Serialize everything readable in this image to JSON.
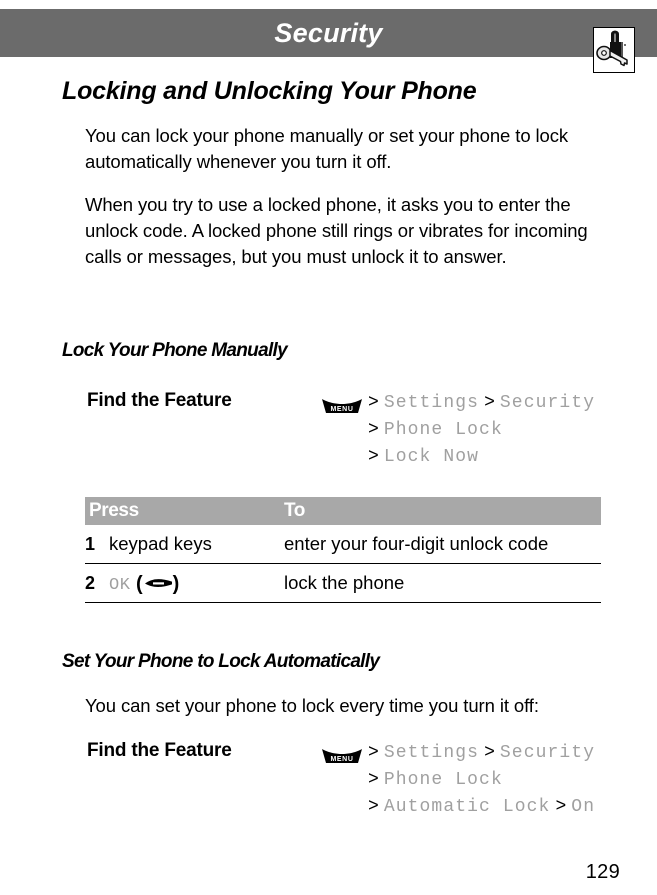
{
  "header": {
    "title": "Security",
    "band_color": "#6b6b6b",
    "icon_name": "padlock-and-key-icon"
  },
  "section": {
    "title": "Locking and Unlocking Your Phone",
    "paragraphs": [
      "You can lock your phone manually or set your phone to lock automatically whenever you turn it off.",
      "When you try to use a locked phone, it asks you to enter the unlock code. A locked phone still rings or vibrates for incoming calls or messages, but you must unlock it to answer."
    ]
  },
  "manual": {
    "subtitle": "Lock Your Phone Manually",
    "find_label": "Find the Feature",
    "menu_key_label": "MENU",
    "path_lines": [
      {
        "items": [
          {
            "sep": ">",
            "name": "Settings"
          },
          {
            "sep": ">",
            "name": "Security"
          }
        ]
      },
      {
        "items": [
          {
            "sep": ">",
            "name": "Phone Lock"
          }
        ]
      },
      {
        "items": [
          {
            "sep": ">",
            "name": "Lock Now"
          }
        ]
      }
    ],
    "table": {
      "columns": [
        "Press",
        "To"
      ],
      "rows": [
        {
          "num": "1",
          "press": "keypad keys",
          "press_mono": "",
          "press_softkey": false,
          "to": "enter your four-digit unlock code"
        },
        {
          "num": "2",
          "press": "",
          "press_mono": "OK",
          "press_softkey": true,
          "to": "lock the phone"
        }
      ]
    }
  },
  "automatic": {
    "subtitle": "Set Your Phone to Lock Automatically",
    "intro": "You can set your phone to lock every time you turn it off:",
    "find_label": "Find the Feature",
    "menu_key_label": "MENU",
    "path_lines": [
      {
        "items": [
          {
            "sep": ">",
            "name": "Settings"
          },
          {
            "sep": ">",
            "name": "Security"
          }
        ]
      },
      {
        "items": [
          {
            "sep": ">",
            "name": "Phone Lock"
          }
        ]
      },
      {
        "items": [
          {
            "sep": ">",
            "name": "Automatic Lock"
          },
          {
            "sep": ">",
            "name": "On"
          }
        ]
      }
    ]
  },
  "footer": {
    "page_number": "129"
  },
  "colors": {
    "header_band": "#6b6b6b",
    "table_header": "#a8a8a8",
    "menu_path_text": "#a0a0a0",
    "body_text": "#000000"
  }
}
